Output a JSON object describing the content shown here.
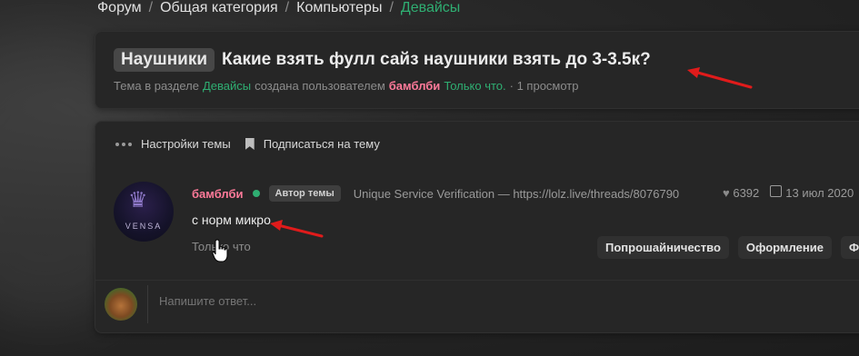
{
  "breadcrumb": {
    "items": [
      "Форум",
      "Общая категория",
      "Компьютеры"
    ],
    "active": "Девайсы",
    "separator": "/"
  },
  "thread": {
    "prefix": "Наушники",
    "title": "Какие взять фулл сайз наушники взять до 3-3.5к?",
    "meta_part1": "Тема в разделе",
    "section": "Девайсы",
    "meta_part2": "создана пользователем",
    "author": "бамблби",
    "time": "Только что.",
    "views": "· 1 просмотр"
  },
  "tools": {
    "settings_label": "Настройки темы",
    "subscribe_label": "Подписаться на тему"
  },
  "post": {
    "avatar_text": "VENSA",
    "author": "бамблби",
    "badge": "Автор темы",
    "signature": "Unique Service Verification — https://lolz.live/threads/8076790",
    "likes": "6392",
    "date": "13 июл 2020",
    "body": "с норм микро",
    "time": "Только что",
    "tags": [
      "Попрошайничество",
      "Оформление",
      "Ф"
    ]
  },
  "reply": {
    "placeholder": "Напишите ответ..."
  },
  "colors": {
    "accent_green": "#2fae72",
    "username_pink": "#ff7a9a",
    "arrow_red": "#e01b1b"
  }
}
